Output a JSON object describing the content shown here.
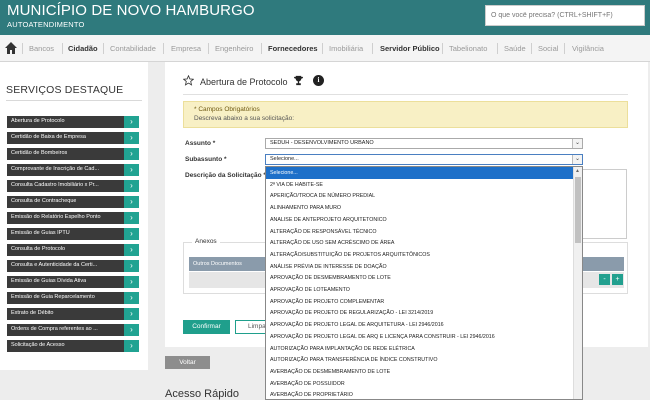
{
  "header": {
    "title": "MUNICÍPIO DE NOVO HAMBURGO",
    "subtitle": "AUTOATENDIMENTO",
    "search_placeholder": "O que você precisa? (CTRL+SHIFT+F)"
  },
  "nav": {
    "items": [
      {
        "label": "Bancos",
        "bold": false
      },
      {
        "label": "Cidadão",
        "bold": true
      },
      {
        "label": "Contabilidade",
        "bold": false
      },
      {
        "label": "Empresa",
        "bold": false
      },
      {
        "label": "Engenheiro",
        "bold": false
      },
      {
        "label": "Fornecedores",
        "bold": true
      },
      {
        "label": "Imobiliária",
        "bold": false
      },
      {
        "label": "Servidor Público",
        "bold": true
      },
      {
        "label": "Tabelionato",
        "bold": false
      },
      {
        "label": "Saúde",
        "bold": false
      },
      {
        "label": "Social",
        "bold": false
      },
      {
        "label": "Vigilância",
        "bold": false
      }
    ]
  },
  "sidebar": {
    "title": "SERVIÇOS DESTAQUE",
    "items": [
      "Abertura de Protocolo",
      "Certidão de Baixa de Empresa",
      "Certidão de Bombeiros",
      "Comprovante de Inscrição de Cad...",
      "Consulta Cadastro Imobiliário x Pr...",
      "Consulta de Contracheque",
      "Emissão do Relatório Espelho Ponto",
      "Emissão de Guias IPTU",
      "Consulta de Protocolo",
      "Consulta e Autenticidade da Certi...",
      "Emissão de Guias Dívida Ativa",
      "Emissão de Guia Reparcelamento",
      "Extrato de Débito",
      "Ordens de Compra referentes ao ...",
      "Solicitação de Acesso"
    ]
  },
  "main": {
    "title": "Abertura de Protocolo",
    "alert_title": "* Campos Obrigatórios",
    "alert_text": "Descreva abaixo a sua solicitação:",
    "assunto_label": "Assunto *",
    "assunto_value": "SEDUH - DESENVOLVIMENTO URBANO",
    "subassunto_label": "Subassunto *",
    "subassunto_value": "Selecione...",
    "descricao_label": "Descrição da Solicitação *",
    "anexos_label": "Anexos",
    "anexos_header": "Outros Documentos",
    "confirm_label": "Confirmar",
    "clear_label": "Limpar",
    "back_label": "Voltar",
    "acesso_label": "Acesso Rápido"
  },
  "dropdown": {
    "options": [
      "Selecione...",
      "2ª VIA DE HABITE-SE",
      "APERIÇÃO/TROCA DE NÚMERO PREDIAL",
      "ALINHAMENTO PARA MURO",
      "ANALISE DE ANTEPROJETO ARQUITETONICO",
      "ALTERAÇÃO DE RESPONSÁVEL TÉCNICO",
      "ALTERAÇÃO DE USO SEM ACRÉSCIMO DE ÁREA",
      "ALTERAÇÃO/SUBSTITUIÇÃO DE PROJETOS ARQUITETÔNICOS",
      "ANÁLISE PRÉVIA DE INTERESSE DE DOAÇÃO",
      "APROVAÇÃO DE DESMEMBRAMENTO DE LOTE",
      "APROVAÇÃO DE LOTEAMENTO",
      "APROVAÇÃO DE PROJETO COMPLEMENTAR",
      "APROVAÇÃO DE PROJETO DE REGULARIZAÇÃO - LEI 3214/2019",
      "APROVAÇÃO DE PROJETO LEGAL DE ARQUITETURA - LEI 2946/2016",
      "APROVAÇÃO DE PROJETO LEGAL DE ARQ E LICENÇA PARA CONSTRUIR - LEI 2946/2016",
      "AUTORIZAÇÃO PARA IMPLANTAÇÃO DE REDE ELÉTRICA",
      "AUTORIZAÇÃO PARA TRANSFERÊNCIA DE ÍNDICE CONSTRUTIVO",
      "AVERBAÇÃO DE DESMEMBRAMENTO DE LOTE",
      "AVERBAÇÃO DE POSSUIDOR",
      "AVERBAÇÃO DE PROPRIETÁRIO"
    ]
  },
  "colors": {
    "header": "#2f7a7d",
    "accent": "#21a392",
    "selection": "#1e70c9"
  }
}
